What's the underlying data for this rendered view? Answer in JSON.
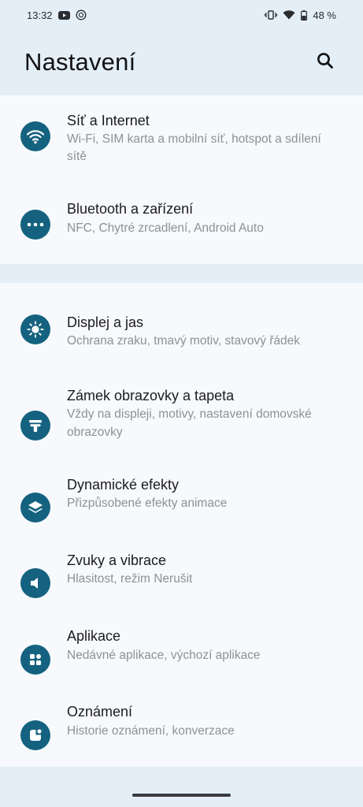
{
  "status_bar": {
    "time": "13:32",
    "battery": "48 %",
    "icons": [
      "youtube-icon",
      "data-saver-icon",
      "vibrate-icon",
      "wifi-icon",
      "battery-icon"
    ]
  },
  "header": {
    "title": "Nastavení",
    "search_icon": "search-icon"
  },
  "colors": {
    "accent": "#14627f",
    "background": "#e4eef6",
    "card": "#f7f9fc",
    "subtitle": "#8e9197"
  },
  "groups": [
    {
      "items": [
        {
          "icon": "wifi-icon",
          "title": "Síť a Internet",
          "subtitle_line1": "Wi-Fi, SIM karta a mobilní síť, hotspot a sdílení",
          "subtitle_line2": "sítě"
        },
        {
          "icon": "more-dots-icon",
          "title": "Bluetooth a zařízení",
          "subtitle_line1": "NFC, Chytré zrcadlení, Android Auto"
        }
      ]
    },
    {
      "items": [
        {
          "icon": "brightness-icon",
          "title": "Displej a jas",
          "subtitle_line1": "Ochrana zraku, tmavý motiv, stavový řádek"
        },
        {
          "icon": "wallpaper-icon",
          "title": "Zámek obrazovky a tapeta",
          "subtitle_line1": "Vždy na displeji, motivy, nastavení domovské",
          "subtitle_line2": "obrazovky"
        },
        {
          "icon": "layers-icon",
          "title": "Dynamické efekty",
          "subtitle_line1": "Přizpůsobené efekty animace"
        },
        {
          "icon": "speaker-icon",
          "title": "Zvuky a vibrace",
          "subtitle_line1": "Hlasitost, režim Nerušit"
        },
        {
          "icon": "apps-grid-icon",
          "title": "Aplikace",
          "subtitle_line1": "Nedávné aplikace, výchozí aplikace"
        },
        {
          "icon": "notification-icon",
          "title": "Oznámení",
          "subtitle_line1": "Historie oznámení, konverzace"
        }
      ]
    }
  ]
}
